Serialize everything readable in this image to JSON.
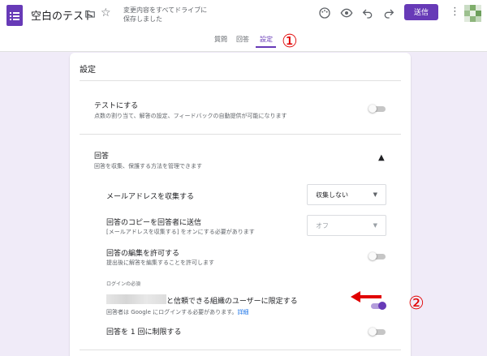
{
  "header": {
    "title": "空白のテスト",
    "save_status": "変更内容をすべてドライブに保存しました",
    "send_label": "送信",
    "icons": [
      "forms-icon",
      "folder-icon",
      "star-icon",
      "palette-icon",
      "preview-eye-icon",
      "undo-icon",
      "redo-icon",
      "more-vert-icon"
    ]
  },
  "tabs": [
    "質問",
    "回答",
    "設定"
  ],
  "annotations": [
    "①",
    "②"
  ],
  "annotation_color": "#e10000",
  "accent": "#673ab7",
  "card": {
    "title": "設定",
    "test": {
      "title": "テストにする",
      "desc": "点数の割り当て、解答の設定、フィードバックの自動提供が可能になります",
      "on": false
    },
    "responses": {
      "title": "回答",
      "desc": "回答を収集、保護する方法を管理できます",
      "collect_email": {
        "label": "メールアドレスを収集する",
        "value": "収集しない"
      },
      "send_copy": {
        "label": "回答のコピーを回答者に送信",
        "desc": "[メールアドレスを収集する] をオンにする必要があります",
        "value": "オフ"
      },
      "allow_edit": {
        "label": "回答の編集を許可する",
        "desc": "提出後に解答を編集することを許可します",
        "on": false
      },
      "login_heading": "ログインの必須",
      "restrict_org": {
        "label": "と信頼できる組織のユーザーに限定する",
        "desc": "回答者は Google にログインする必要があります。",
        "link": "詳細",
        "on": true
      },
      "limit_one": {
        "label": "回答を 1 回に制限する",
        "on": false
      }
    }
  }
}
